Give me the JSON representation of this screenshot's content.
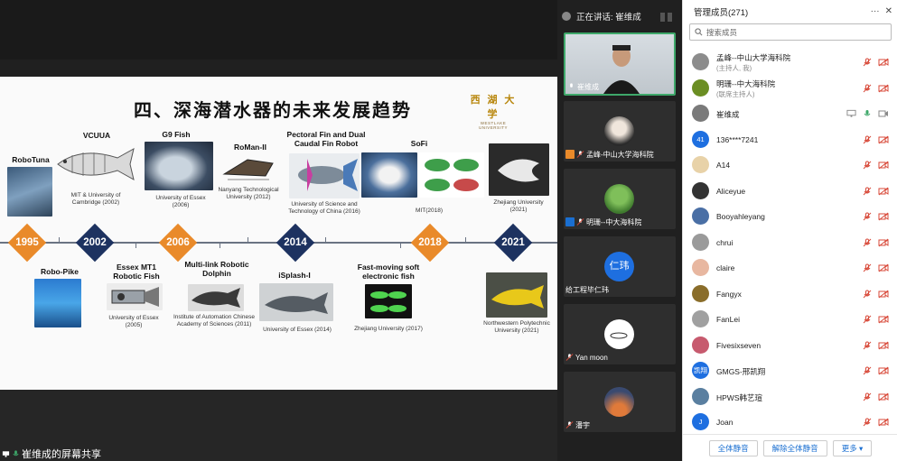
{
  "share": {
    "label": "崔维成的屏幕共享"
  },
  "slide": {
    "title": "四、深海潜水器的未来发展趋势",
    "logo_cn": "西 湖 大 学",
    "logo_en": "WESTLAKE UNIVERSITY",
    "years": [
      "1995",
      "2002",
      "2006",
      "2014",
      "2018",
      "2021"
    ],
    "labels": {
      "robotuna": "RoboTuna",
      "vcuua": "VCUUA",
      "vcuua_cap": "MIT & University of Cambridge (2002)",
      "g9": "G9 Fish",
      "g9_cap": "University of Essex (2006)",
      "roman": "RoMan-II",
      "roman_cap": "Nanyang Technological University (2012)",
      "pectoral": "Pectoral Fin and Dual Caudal Fin Robot",
      "pectoral_cap": "University of Science and Technology of China (2016)",
      "sofi": "SoFi",
      "sofi_cap": "MIT(2018)",
      "zju_top_cap": "Zhejiang University (2021)",
      "robopike": "Robo-Pike",
      "essex": "Essex MT1 Robotic Fish",
      "essex_cap": "University of Essex (2005)",
      "dolphin": "Multi-link Robotic Dolphin",
      "dolphin_cap": "Institute of Automation Chinese Academy of Sciences (2011)",
      "isplash": "iSplash-I",
      "isplash_cap": "University of Essex (2014)",
      "fastmoving": "Fast-moving soft electronic fish",
      "fastmoving_cap": "Zhejiang University (2017)",
      "nwpu_cap": "Northwestern Polytechnic University (2021)"
    }
  },
  "video": {
    "speaking_label": "正在讲话: 崔维成",
    "tiles": [
      {
        "name": "崔维成"
      },
      {
        "name": "孟峰-中山大学海科院"
      },
      {
        "name": "明珊--中大海科院"
      },
      {
        "name": "给工程毕仁玮",
        "avatar_text": "仁玮"
      },
      {
        "name": "Yan moon"
      },
      {
        "name": "潘宇"
      }
    ]
  },
  "panel": {
    "title": "管理成员(271)",
    "search_placeholder": "搜索成员",
    "participants": [
      {
        "name": "孟峰--中山大学海科院",
        "role": "(主持人, 我)",
        "avatar_color": "#8c8c8c"
      },
      {
        "name": "明珊--中大海科院",
        "role": "(联席主持人)",
        "avatar_color": "#6b8e23"
      },
      {
        "name": "崔维成",
        "role": "",
        "avatar_color": "#7a7a7a"
      },
      {
        "name": "136****7241",
        "role": "",
        "avatar_color": "#1e6fe0",
        "avatar_text": "41"
      },
      {
        "name": "A14",
        "role": "",
        "avatar_color": "#e8d2a8"
      },
      {
        "name": "Aliceyue",
        "role": "",
        "avatar_color": "#333333"
      },
      {
        "name": "Booyahleyang",
        "role": "",
        "avatar_color": "#4a6fa5"
      },
      {
        "name": "chrui",
        "role": "",
        "avatar_color": "#9a9a9a"
      },
      {
        "name": "claire",
        "role": "",
        "avatar_color": "#e8b7a0"
      },
      {
        "name": "Fangyx",
        "role": "",
        "avatar_color": "#8a6d2a"
      },
      {
        "name": "FanLei",
        "role": "",
        "avatar_color": "#a0a0a0"
      },
      {
        "name": "Fivesixseven",
        "role": "",
        "avatar_color": "#c75a6e"
      },
      {
        "name": "GMGS-邢凯翔",
        "role": "",
        "avatar_color": "#1e6fe0",
        "avatar_text": "凯翔"
      },
      {
        "name": "HPWS韩艺瑄",
        "role": "",
        "avatar_color": "#5a7fa0"
      },
      {
        "name": "Joan",
        "role": "",
        "avatar_color": "#1e6fe0",
        "avatar_text": "J"
      }
    ],
    "footer": {
      "mute_all": "全体静音",
      "unmute_all": "解除全体静音",
      "more": "更多 ▾"
    }
  },
  "colors": {
    "orange": "#e98a2a",
    "navy": "#1d3260",
    "muted_red": "#d84a3a",
    "active_green": "#3ea86a",
    "link_blue": "#1a6fd1"
  }
}
